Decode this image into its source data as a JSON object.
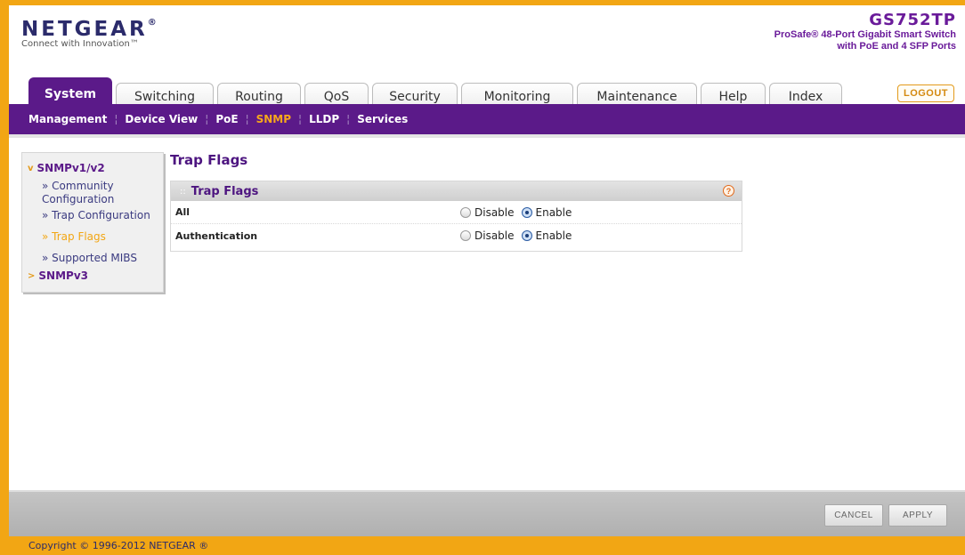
{
  "header": {
    "brand": "NETGEAR",
    "brand_mark": "®",
    "tagline": "Connect with Innovation™",
    "model": "GS752TP",
    "description_line1": "ProSafe® 48-Port Gigabit Smart Switch",
    "description_line2": "with PoE and 4 SFP Ports",
    "logout_label": "LOGOUT"
  },
  "tabs": [
    {
      "label": "System",
      "active": true
    },
    {
      "label": "Switching",
      "active": false
    },
    {
      "label": "Routing",
      "active": false
    },
    {
      "label": "QoS",
      "active": false
    },
    {
      "label": "Security",
      "active": false
    },
    {
      "label": "Monitoring",
      "active": false
    },
    {
      "label": "Maintenance",
      "active": false
    },
    {
      "label": "Help",
      "active": false
    },
    {
      "label": "Index",
      "active": false
    }
  ],
  "subnav": [
    {
      "label": "Management",
      "active": false
    },
    {
      "label": "Device View",
      "active": false
    },
    {
      "label": "PoE",
      "active": false
    },
    {
      "label": "SNMP",
      "active": true
    },
    {
      "label": "LLDP",
      "active": false
    },
    {
      "label": "Services",
      "active": false
    }
  ],
  "sidebar": {
    "groups": [
      {
        "label": "SNMPv1/v2",
        "arrow": "v",
        "items": [
          {
            "label": "» Community Configuration",
            "active": false
          },
          {
            "label": "» Trap Configuration",
            "active": false
          },
          {
            "label": "» Trap Flags",
            "active": true
          },
          {
            "label": "» Supported MIBS",
            "active": false
          }
        ]
      },
      {
        "label": "SNMPv3",
        "arrow": ">",
        "items": []
      }
    ]
  },
  "content": {
    "page_title": "Trap Flags",
    "panel_title": "Trap Flags",
    "help_icon": "?",
    "rows": [
      {
        "label": "All",
        "disable_label": "Disable",
        "enable_label": "Enable",
        "value": "enable"
      },
      {
        "label": "Authentication",
        "disable_label": "Disable",
        "enable_label": "Enable",
        "value": "enable"
      }
    ]
  },
  "actions": {
    "cancel_label": "CANCEL",
    "apply_label": "APPLY"
  },
  "footer": {
    "copyright": "Copyright © 1996-2012 NETGEAR ®"
  },
  "colors": {
    "brand_purple": "#5b1a89",
    "brand_orange": "#f2a614",
    "navy": "#2b2b6b"
  }
}
